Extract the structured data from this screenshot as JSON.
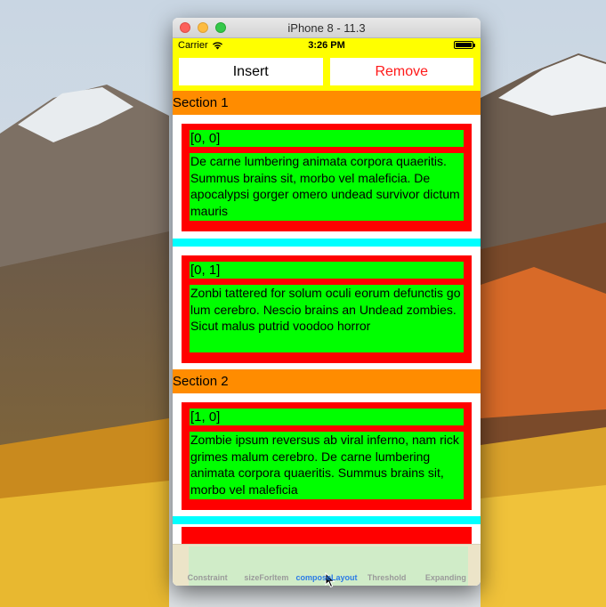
{
  "window": {
    "title": "iPhone 8 - 11.3"
  },
  "status_bar": {
    "carrier": "Carrier",
    "time": "3:26 PM"
  },
  "toolbar": {
    "insert_label": "Insert",
    "remove_label": "Remove"
  },
  "sections": [
    {
      "title": "Section 1",
      "cells": [
        {
          "index": "[0, 0]",
          "text": " De carne lumbering animata corpora quaeritis.  Summus brains sit, morbo vel maleficia.  De apocalypsi gorger omero undead survivor dictum mauris"
        },
        {
          "index": "[0, 1]",
          "text": " Zonbi tattered for solum oculi eorum defunctis go lum cerebro.  Nescio brains an Undead zombies.  Sicut malus putrid voodoo horror"
        }
      ]
    },
    {
      "title": "Section 2",
      "cells": [
        {
          "index": "[1, 0]",
          "text": "Zombie ipsum reversus ab viral inferno, nam rick grimes malum cerebro.  De carne lumbering animata corpora quaeritis.  Summus brains sit, morbo vel maleficia"
        }
      ]
    }
  ],
  "tabs": [
    {
      "label": "Constraint",
      "active": false
    },
    {
      "label": "sizeForItem",
      "active": false
    },
    {
      "label": "composeLayout",
      "active": true
    },
    {
      "label": "Threshold",
      "active": false
    },
    {
      "label": "Expanding",
      "active": false
    }
  ],
  "colors": {
    "status_bar": "#ffff00",
    "section_header": "#ff8c00",
    "cell_border": "#ff0000",
    "cell_content": "#00ff00",
    "separator": "#00ffff",
    "active_tab": "#2b7be6"
  }
}
